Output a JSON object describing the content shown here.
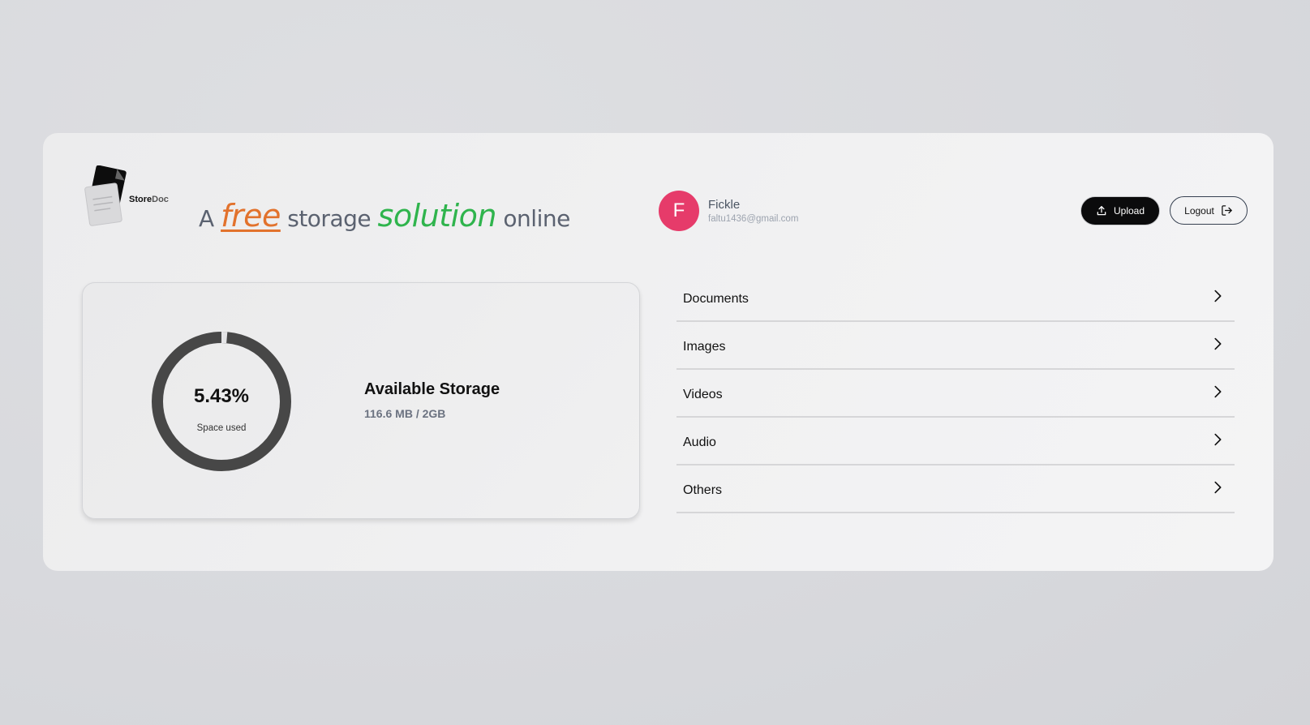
{
  "brand": {
    "name_part1": "Store",
    "name_part2": "Doc",
    "tagline": {
      "a": "A",
      "free": "free",
      "storage": "storage",
      "solution": "solution",
      "online": "online"
    }
  },
  "user": {
    "initial": "F",
    "name": "Fickle",
    "email": "faltu1436@gmail.com"
  },
  "actions": {
    "upload_label": "Upload",
    "logout_label": "Logout"
  },
  "storage": {
    "percent_label": "5.43%",
    "used_fraction": 0.0543,
    "caption": "Space used",
    "title": "Available Storage",
    "usage": "116.6 MB / 2GB"
  },
  "categories": [
    {
      "label": "Documents"
    },
    {
      "label": "Images"
    },
    {
      "label": "Videos"
    },
    {
      "label": "Audio"
    },
    {
      "label": "Others"
    }
  ],
  "colors": {
    "avatar": "#e63b6a",
    "free": "#e2722c",
    "solution": "#2fb44d",
    "ring": "#474747"
  }
}
